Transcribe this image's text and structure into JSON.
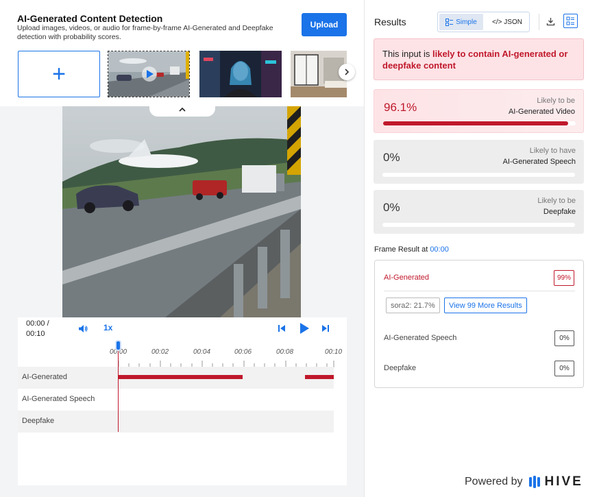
{
  "header": {
    "title": "AI-Generated Content Detection",
    "subtitle": "Upload images, videos, or audio for frame-by-frame AI-Generated and Deepfake detection with probability scores.",
    "upload_label": "Upload"
  },
  "player": {
    "time_current": "00:00 /",
    "time_total": "00:10",
    "speed": "1x",
    "ticks": [
      "00:00",
      "00:02",
      "00:04",
      "00:06",
      "00:08",
      "00:10"
    ],
    "tracks": [
      "AI-Generated",
      "AI-Generated Speech",
      "Deepfake"
    ]
  },
  "results": {
    "title": "Results",
    "view_simple": "Simple",
    "view_json": "</> JSON",
    "summary_prefix": "This input is ",
    "summary_highlight": "likely to contain AI-generated or deepfake content",
    "cards": [
      {
        "pct": "96.1%",
        "line1": "Likely to be",
        "line2": "AI-Generated Video",
        "fill": 0.961
      },
      {
        "pct": "0%",
        "line1": "Likely to have",
        "line2": "AI-Generated Speech",
        "fill": 0
      },
      {
        "pct": "0%",
        "line1": "Likely to be",
        "line2": "Deepfake",
        "fill": 0
      }
    ],
    "frame_label": "Frame Result at",
    "frame_time": "00:00",
    "frame": {
      "ai_label": "AI-Generated",
      "ai_value": "99%",
      "chip_model": "sora2: 21.7%",
      "chip_more": "View 99 More Results",
      "speech_label": "AI-Generated Speech",
      "speech_value": "0%",
      "deepfake_label": "Deepfake",
      "deepfake_value": "0%"
    }
  },
  "footer": {
    "powered_by": "Powered by",
    "brand": "HIVE"
  },
  "colors": {
    "accent": "#1a73e8",
    "alert": "#c0182b"
  }
}
